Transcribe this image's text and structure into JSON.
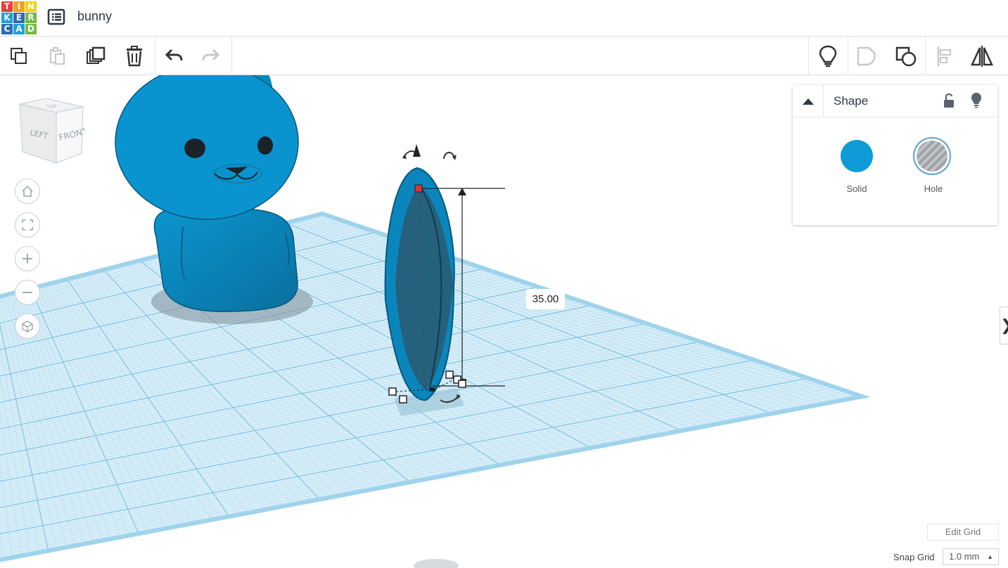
{
  "app": {
    "logo_letters": [
      "T",
      "I",
      "N",
      "K",
      "E",
      "R",
      "C",
      "A",
      "D"
    ],
    "logo_colors": [
      "#e2403a",
      "#f3a11f",
      "#f5d100",
      "#1f9ed9",
      "#2d6ab3",
      "#73b942",
      "#2d6ab3",
      "#1f9ed9",
      "#73b942"
    ],
    "document_title": "bunny"
  },
  "toolbar": {
    "left": [
      {
        "name": "copy-button",
        "icon": "copy-icon",
        "enabled": true
      },
      {
        "name": "paste-button",
        "icon": "paste-icon",
        "enabled": false
      },
      {
        "name": "duplicate-button",
        "icon": "duplicate-icon",
        "enabled": true
      },
      {
        "name": "delete-button",
        "icon": "trash-icon",
        "enabled": true
      },
      {
        "name": "undo-button",
        "icon": "undo-icon",
        "enabled": true
      },
      {
        "name": "redo-button",
        "icon": "redo-icon",
        "enabled": false
      }
    ],
    "right": [
      {
        "name": "show-all-button",
        "icon": "lightbulb-icon",
        "enabled": true
      },
      {
        "name": "group-button",
        "icon": "group-icon",
        "enabled": false
      },
      {
        "name": "ungroup-button",
        "icon": "ungroup-icon",
        "enabled": true
      },
      {
        "name": "align-button",
        "icon": "align-icon",
        "enabled": false
      },
      {
        "name": "mirror-button",
        "icon": "mirror-icon",
        "enabled": true
      }
    ]
  },
  "viewcube": {
    "front_label": "FRONT",
    "left_label": "LEFT",
    "top_label": "TOP"
  },
  "nav_controls": [
    "home-view",
    "fit-view",
    "zoom-in",
    "zoom-out",
    "perspective-toggle"
  ],
  "dimension": {
    "value": "35.00"
  },
  "shape_panel": {
    "title": "Shape",
    "solid_label": "Solid",
    "hole_label": "Hole",
    "solid_color": "#0f9bd7",
    "selected": "Hole"
  },
  "grid": {
    "edit_grid_label": "Edit Grid",
    "snap_grid_label": "Snap Grid",
    "snap_grid_value": "1.0 mm"
  },
  "side_tab": {
    "glyph": "❯"
  }
}
